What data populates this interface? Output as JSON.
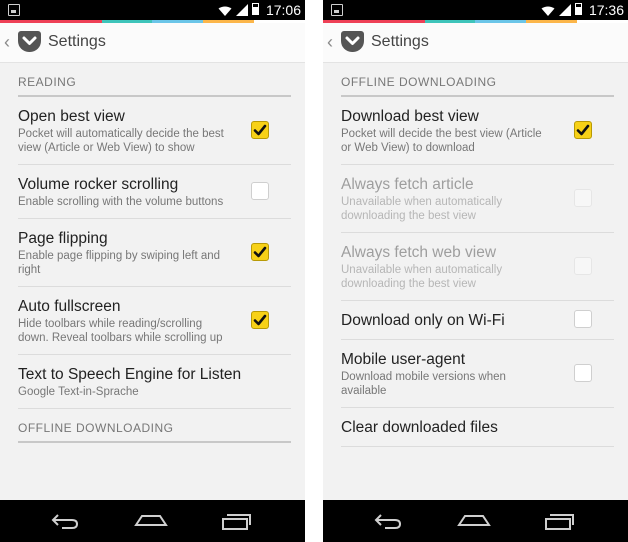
{
  "colors": {
    "accent_strip": [
      "#ee4056",
      "#ee4056",
      "#3ec4ba",
      "#6bc5e8",
      "#fcb64a",
      "#ffffff"
    ],
    "checkbox_checked": "#f7d117"
  },
  "left": {
    "status": {
      "time": "17:06"
    },
    "actionbar": {
      "title": "Settings",
      "back_icon": "chevron-left-icon",
      "logo_icon": "pocket-logo-icon"
    },
    "sections": [
      {
        "title": "READING",
        "items": [
          {
            "title": "Open best view",
            "summary": "Pocket will automatically decide the best view (Article or Web View) to show",
            "checkbox": true,
            "checked": true,
            "enabled": true
          },
          {
            "title": "Volume rocker scrolling",
            "summary": "Enable scrolling with the volume buttons",
            "checkbox": true,
            "checked": false,
            "enabled": true
          },
          {
            "title": "Page flipping",
            "summary": "Enable page flipping by swiping left and right",
            "checkbox": true,
            "checked": true,
            "enabled": true
          },
          {
            "title": "Auto fullscreen",
            "summary": "Hide toolbars while reading/scrolling down. Reveal toolbars while scrolling up",
            "checkbox": true,
            "checked": true,
            "enabled": true
          },
          {
            "title": "Text to Speech Engine for Listen",
            "summary": "Google Text-in-Sprache",
            "checkbox": false,
            "enabled": true
          }
        ]
      },
      {
        "title": "OFFLINE DOWNLOADING",
        "items": []
      }
    ]
  },
  "right": {
    "status": {
      "time": "17:36"
    },
    "actionbar": {
      "title": "Settings",
      "back_icon": "chevron-left-icon",
      "logo_icon": "pocket-logo-icon"
    },
    "sections": [
      {
        "title": "OFFLINE DOWNLOADING",
        "items": [
          {
            "title": "Download best view",
            "summary": "Pocket will decide the best view (Article or Web View) to download",
            "checkbox": true,
            "checked": true,
            "enabled": true
          },
          {
            "title": "Always fetch article",
            "summary": "Unavailable when automatically downloading the best view",
            "checkbox": true,
            "checked": false,
            "enabled": false
          },
          {
            "title": "Always fetch web view",
            "summary": "Unavailable when automatically downloading the best view",
            "checkbox": true,
            "checked": false,
            "enabled": false
          },
          {
            "title": "Download only on Wi-Fi",
            "summary": "",
            "checkbox": true,
            "checked": false,
            "enabled": true
          },
          {
            "title": "Mobile user-agent",
            "summary": "Download mobile versions when available",
            "checkbox": true,
            "checked": false,
            "enabled": true
          },
          {
            "title": "Clear downloaded files",
            "summary": "",
            "checkbox": false,
            "enabled": true
          }
        ]
      }
    ]
  },
  "navbar": {
    "icons": [
      "back-nav-icon",
      "home-nav-icon",
      "recents-nav-icon"
    ]
  }
}
